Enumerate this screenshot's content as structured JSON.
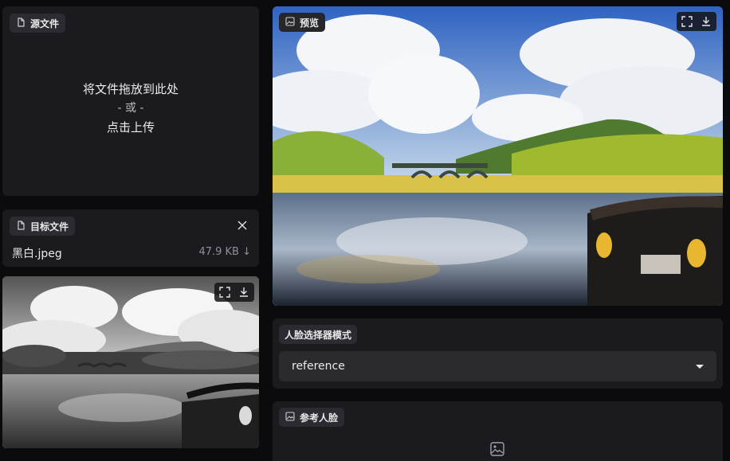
{
  "source": {
    "label": "源文件",
    "drop_text": "将文件拖放到此处",
    "or_text": "- 或 -",
    "upload_text": "点击上传"
  },
  "target": {
    "label": "目标文件",
    "file_name": "黑白.jpeg",
    "file_size": "47.9 KB ↓"
  },
  "preview": {
    "label": "预览"
  },
  "face_selector": {
    "label": "人脸选择器模式",
    "value": "reference"
  },
  "reference_face": {
    "label": "参考人脸"
  },
  "icons": [
    "file-icon",
    "image-icon",
    "close-icon",
    "fullscreen-icon",
    "download-icon",
    "chevron-down-icon",
    "image-placeholder-icon"
  ]
}
